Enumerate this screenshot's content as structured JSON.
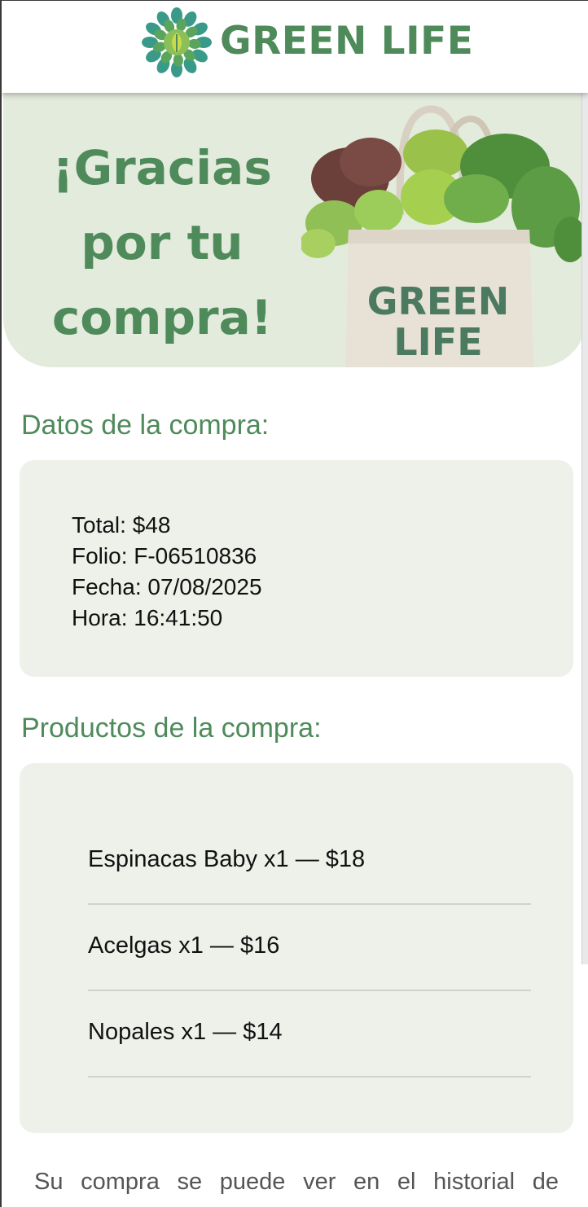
{
  "header": {
    "brand": "GREEN LIFE"
  },
  "hero": {
    "title_line1": "¡Gracias",
    "title_line2": "por tu",
    "title_line3": "compra!",
    "bag_text_line1": "GREEN",
    "bag_text_line2": "LIFE"
  },
  "purchase": {
    "section_title": "Datos de la compra:",
    "total": "Total: $48",
    "folio": "Folio: F-06510836",
    "fecha": "Fecha: 07/08/2025",
    "hora": "Hora: 16:41:50"
  },
  "products": {
    "section_title": "Productos de la compra:",
    "items": [
      "Espinacas Baby x1 — $18",
      "Acelgas x1 — $16",
      "Nopales x1 — $14"
    ]
  },
  "footer": {
    "note": "Su compra se puede ver en el historial de"
  },
  "colors": {
    "brand_green": "#4f8a5b",
    "hero_bg": "#e3ebdd",
    "card_bg": "#eef1ea"
  }
}
